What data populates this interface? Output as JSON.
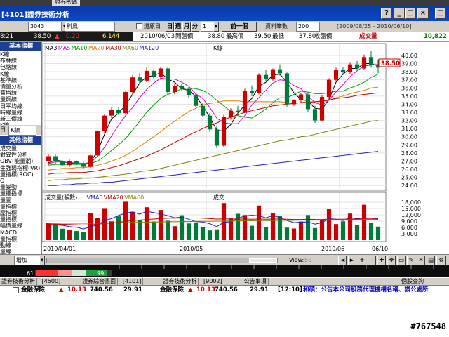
{
  "top_tab": "證券密碼",
  "window": {
    "title": "[4101]證券技術分析",
    "btn_help": "?",
    "btn_min": "_",
    "btn_max": "□",
    "btn_close": "×",
    "btn_extra": "□"
  },
  "toolbar": {
    "code_value": "3043",
    "name_value": "科風",
    "restore_label": "還原日",
    "period_day": "日",
    "period_week": "週",
    "period_month": "月",
    "period_minute": "分",
    "period_select": "1",
    "prev_button": "前一個",
    "data_count_label": "資料筆數",
    "data_count_value": "200",
    "date_range": "[2009/08/25 - 2010/06/10]"
  },
  "quote": {
    "time": "8:21",
    "price": "38.50",
    "change": "0.20",
    "volume": "6,144",
    "date": "2010/06/03",
    "open_label": "開盤價",
    "open_value": "38.80",
    "high_label": "最高價",
    "high_value": "39.50",
    "low_label": "最低",
    "low_value": "37.80",
    "close_label": "收盤價",
    "vol_label": "成交量",
    "vol_value": "10,822"
  },
  "sidebar": {
    "basic_header": "基本指標",
    "basic_items": [
      "K線",
      "布林線",
      "包絡線",
      "K線",
      "基準線",
      "價量分析",
      "寶塔線",
      "量鋼線",
      "日平均線",
      "時線量線",
      "新三價線",
      "K線"
    ],
    "period_label": "K線",
    "other_header": "其他指標",
    "other_items": [
      "成交量",
      "對異性分析",
      "OBV(能量潮)",
      "生強弱指標(VR)",
      "量指標(ROC)",
      "O",
      "量變動",
      "量擺指標",
      "量圖",
      "量指標",
      "壓指標",
      "量指標",
      "幅價量線",
      "MACD",
      "量指標",
      "動線",
      "量線"
    ],
    "bottom_select": "增加"
  },
  "chart_labels": {
    "ma_legend": [
      {
        "text": "MA3",
        "color": "#000000"
      },
      {
        "text": "MA5",
        "color": "#d000d0"
      },
      {
        "text": "MA10",
        "color": "#00a000"
      },
      {
        "text": "MA20",
        "color": "#e08000"
      },
      {
        "text": "MA30",
        "color": "#c00000"
      },
      {
        "text": "MA60",
        "color": "#808000"
      },
      {
        "text": "MA120",
        "color": "#2020c0"
      }
    ],
    "kline_tag": "K線",
    "vol_legend": [
      {
        "text": "成交量(張數)",
        "color": "#000000"
      },
      {
        "text": "VMA5",
        "color": "#2020c0"
      },
      {
        "text": "VMA20",
        "color": "#c00000"
      },
      {
        "text": "VMA60",
        "color": "#808000"
      }
    ],
    "vol_tag": "成交",
    "price_tag": "38.50",
    "x_dates": [
      "2010/04/01",
      "2010/05",
      "2010/06",
      "06/10"
    ]
  },
  "chart_data": {
    "type": "candlestick",
    "price_axis": [
      40.0,
      39.0,
      38.0,
      37.0,
      36.0,
      35.0,
      34.0,
      33.0,
      32.0,
      31.0,
      30.0,
      29.0,
      28.0,
      27.0,
      26.0,
      25.0,
      24.0
    ],
    "price_ylim": [
      23.5,
      40.6
    ],
    "volume_axis": [
      18000,
      15000,
      12000,
      9000,
      6000,
      3000
    ],
    "volume_ylim": [
      0,
      20000
    ],
    "candles": [
      [
        27.0,
        27.9,
        26.5,
        27.6
      ],
      [
        27.6,
        27.8,
        26.6,
        27.0
      ],
      [
        27.0,
        27.1,
        26.4,
        26.5
      ],
      [
        26.5,
        27.2,
        26.3,
        27.0
      ],
      [
        27.0,
        27.1,
        26.5,
        26.6
      ],
      [
        26.6,
        26.9,
        26.0,
        26.3
      ],
      [
        26.3,
        27.8,
        26.2,
        27.7
      ],
      [
        27.7,
        30.8,
        27.6,
        30.7
      ],
      [
        30.7,
        32.8,
        30.4,
        32.6
      ],
      [
        32.6,
        33.6,
        32.3,
        33.3
      ],
      [
        33.3,
        33.6,
        32.7,
        32.9
      ],
      [
        32.9,
        35.6,
        32.8,
        35.5
      ],
      [
        35.5,
        37.6,
        35.2,
        37.3
      ],
      [
        37.3,
        37.8,
        36.5,
        36.9
      ],
      [
        36.9,
        38.5,
        36.7,
        38.1
      ],
      [
        38.1,
        38.3,
        37.2,
        37.4
      ],
      [
        37.4,
        38.6,
        37.0,
        38.4
      ],
      [
        38.4,
        38.5,
        35.2,
        35.5
      ],
      [
        35.5,
        36.6,
        35.2,
        36.2
      ],
      [
        36.2,
        36.5,
        35.6,
        35.9
      ],
      [
        35.9,
        36.1,
        34.8,
        35.1
      ],
      [
        35.1,
        35.4,
        33.6,
        33.8
      ],
      [
        33.8,
        34.2,
        32.4,
        32.6
      ],
      [
        32.6,
        32.9,
        30.6,
        30.9
      ],
      [
        30.9,
        31.4,
        28.6,
        28.9
      ],
      [
        28.9,
        32.7,
        28.7,
        32.4
      ],
      [
        32.4,
        33.5,
        32.1,
        33.2
      ],
      [
        33.2,
        33.8,
        32.7,
        33.0
      ],
      [
        33.0,
        35.9,
        32.9,
        35.6
      ],
      [
        35.6,
        36.3,
        35.0,
        35.4
      ],
      [
        35.4,
        37.8,
        35.2,
        37.6
      ],
      [
        37.6,
        38.2,
        36.8,
        37.1
      ],
      [
        37.1,
        38.4,
        36.9,
        38.3
      ],
      [
        38.3,
        38.9,
        37.5,
        37.8
      ],
      [
        37.8,
        37.9,
        33.7,
        34.0
      ],
      [
        34.0,
        34.6,
        33.8,
        34.5
      ],
      [
        34.5,
        35.4,
        34.1,
        35.2
      ],
      [
        35.2,
        35.5,
        33.1,
        33.4
      ],
      [
        33.4,
        33.8,
        31.7,
        32.0
      ],
      [
        32.0,
        35.1,
        31.9,
        34.9
      ],
      [
        34.9,
        37.2,
        34.6,
        37.0
      ],
      [
        37.0,
        38.5,
        36.7,
        38.2
      ],
      [
        38.2,
        38.6,
        37.6,
        38.0
      ],
      [
        38.0,
        39.1,
        37.7,
        38.9
      ],
      [
        38.9,
        39.3,
        38.1,
        38.4
      ],
      [
        38.4,
        40.1,
        38.2,
        39.8
      ],
      [
        39.8,
        40.6,
        38.5,
        38.8
      ],
      [
        38.8,
        39.5,
        37.8,
        38.5
      ]
    ],
    "volumes": [
      8200,
      7600,
      5400,
      4900,
      4300,
      3900,
      12800,
      10400,
      15200,
      8900,
      11300,
      18200,
      13400,
      9700,
      15600,
      8800,
      14300,
      9200,
      6600,
      11800,
      7900,
      8400,
      6200,
      4600,
      5100,
      17600,
      10300,
      12500,
      11900,
      6800,
      16400,
      6100,
      12700,
      11600,
      5900,
      5500,
      8800,
      11900,
      5700,
      9400,
      14900,
      7600,
      8900,
      12600,
      7200,
      16800,
      8300,
      6400
    ],
    "ma_series": [
      {
        "name": "MA3",
        "color": "#000000",
        "values": [
          26.8,
          27.1,
          27.0,
          26.7,
          26.7,
          26.6,
          26.9,
          28.2,
          30.3,
          32.2,
          32.9,
          33.9,
          35.2,
          36.6,
          37.4,
          37.5,
          37.9,
          37.1,
          36.7,
          35.9,
          35.7,
          35.0,
          33.8,
          32.4,
          30.8,
          30.7,
          31.5,
          32.9,
          33.9,
          34.7,
          36.2,
          36.7,
          37.6,
          37.7,
          36.7,
          35.4,
          34.6,
          34.4,
          33.5,
          33.4,
          34.6,
          36.7,
          37.7,
          38.4,
          38.4,
          39.0,
          39.0,
          38.7
        ]
      },
      {
        "name": "MA5",
        "color": "#d000d0",
        "values": [
          26.7,
          26.9,
          26.9,
          26.8,
          26.8,
          26.7,
          26.8,
          27.6,
          28.7,
          30.1,
          31.4,
          32.6,
          33.6,
          34.8,
          35.8,
          36.6,
          37.2,
          37.1,
          37.1,
          36.7,
          36.2,
          35.3,
          34.7,
          33.6,
          32.3,
          31.7,
          31.6,
          31.6,
          32.6,
          33.9,
          34.8,
          35.7,
          36.6,
          37.0,
          36.9,
          36.3,
          35.9,
          35.0,
          34.2,
          33.9,
          34.5,
          35.5,
          36.4,
          37.4,
          38.1,
          38.7,
          38.8,
          38.9
        ]
      },
      {
        "name": "MA10",
        "color": "#00a000",
        "values": [
          26.5,
          26.6,
          26.6,
          26.6,
          26.6,
          26.6,
          26.7,
          27.0,
          27.6,
          28.3,
          29.0,
          29.8,
          30.8,
          31.9,
          33.0,
          33.9,
          34.7,
          35.2,
          35.5,
          35.9,
          36.0,
          35.9,
          35.7,
          35.2,
          34.5,
          33.8,
          33.1,
          32.6,
          32.4,
          32.3,
          32.8,
          33.4,
          34.2,
          34.8,
          34.8,
          35.2,
          35.6,
          35.5,
          35.3,
          35.3,
          35.4,
          35.6,
          35.6,
          36.0,
          36.3,
          36.7,
          37.3,
          37.7
        ]
      },
      {
        "name": "MA20",
        "color": "#e08000",
        "values": [
          25.9,
          26.0,
          26.1,
          26.1,
          26.2,
          26.2,
          26.3,
          26.5,
          26.7,
          27.0,
          27.3,
          27.7,
          28.2,
          28.8,
          29.4,
          30.0,
          30.6,
          31.3,
          31.9,
          32.5,
          33.1,
          33.5,
          33.9,
          34.1,
          34.2,
          34.4,
          34.4,
          34.4,
          34.3,
          34.3,
          34.3,
          34.3,
          34.3,
          34.3,
          34.2,
          34.1,
          34.2,
          34.3,
          34.3,
          34.3,
          34.5,
          34.8,
          35.0,
          35.3,
          35.5,
          35.7,
          36.0,
          36.1
        ]
      },
      {
        "name": "MA30",
        "color": "#c00000",
        "values": [
          25.4,
          25.5,
          25.5,
          25.6,
          25.6,
          25.6,
          25.7,
          25.8,
          26.0,
          26.2,
          26.4,
          26.7,
          27.0,
          27.3,
          27.6,
          28.0,
          28.4,
          28.8,
          29.3,
          29.7,
          30.2,
          30.6,
          31.0,
          31.4,
          31.7,
          32.1,
          32.4,
          32.7,
          33.0,
          33.2,
          33.4,
          33.6,
          33.8,
          33.9,
          34.0,
          34.1,
          34.2,
          34.2,
          34.3,
          34.4,
          34.5,
          34.7,
          34.8,
          34.9,
          35.1,
          35.2,
          35.3,
          35.4
        ]
      },
      {
        "name": "MA60",
        "color": "#808000",
        "values": [
          24.6,
          24.7,
          24.7,
          24.8,
          24.8,
          24.9,
          24.9,
          25.0,
          25.1,
          25.2,
          25.3,
          25.4,
          25.5,
          25.7,
          25.8,
          25.9,
          26.1,
          26.3,
          26.5,
          26.7,
          26.9,
          27.1,
          27.3,
          27.5,
          27.7,
          27.9,
          28.1,
          28.3,
          28.5,
          28.7,
          28.9,
          29.1,
          29.3,
          29.5,
          29.6,
          29.8,
          30.0,
          30.1,
          30.3,
          30.5,
          30.7,
          30.9,
          31.1,
          31.3,
          31.5,
          31.7,
          31.9,
          32.0
        ]
      },
      {
        "name": "MA120",
        "color": "#2020c0",
        "values": [
          24.0,
          24.0,
          24.1,
          24.1,
          24.2,
          24.2,
          24.3,
          24.3,
          24.4,
          24.4,
          24.5,
          24.6,
          24.7,
          24.8,
          24.9,
          25.0,
          25.1,
          25.2,
          25.3,
          25.4,
          25.5,
          25.6,
          25.7,
          25.8,
          25.9,
          26.0,
          26.1,
          26.2,
          26.3,
          26.4,
          26.5,
          26.6,
          26.7,
          26.8,
          26.9,
          27.0,
          27.1,
          27.2,
          27.3,
          27.4,
          27.5,
          27.6,
          27.7,
          27.8,
          27.9,
          28.0,
          28.1,
          28.2
        ]
      }
    ],
    "vma_series": [
      {
        "name": "VMA5",
        "color": "#2020c0",
        "values": [
          7000,
          7200,
          7000,
          6400,
          6100,
          5300,
          6300,
          7200,
          9300,
          10200,
          11700,
          12800,
          13400,
          12300,
          13600,
          13100,
          12400,
          11600,
          10600,
          10900,
          9900,
          8800,
          8600,
          7800,
          6400,
          8400,
          8700,
          10300,
          11500,
          11800,
          11500,
          10600,
          11600,
          10700,
          9300,
          8300,
          8500,
          8600,
          7600,
          8300,
          10200,
          9900,
          9300,
          10700,
          10200,
          10600,
          10500,
          10200
        ]
      },
      {
        "name": "VMA20",
        "color": "#c00000",
        "values": [
          7600,
          7600,
          7500,
          7400,
          7300,
          7200,
          7300,
          7500,
          7900,
          8100,
          8400,
          8900,
          9300,
          9500,
          9800,
          10000,
          10200,
          10400,
          10400,
          10500,
          10500,
          10500,
          10400,
          10200,
          10000,
          10100,
          10000,
          10000,
          10000,
          9900,
          10000,
          9900,
          10000,
          10000,
          9900,
          9800,
          9800,
          9900,
          9800,
          9800,
          9900,
          9900,
          9900,
          10000,
          10000,
          10100,
          10100,
          10000
        ]
      },
      {
        "name": "VMA60",
        "color": "#808000",
        "values": [
          8000,
          8000,
          8000,
          8000,
          8000,
          8000,
          8000,
          8100,
          8100,
          8200,
          8200,
          8300,
          8400,
          8400,
          8500,
          8600,
          8600,
          8700,
          8700,
          8800,
          8800,
          8900,
          8900,
          8900,
          9000,
          9000,
          9100,
          9100,
          9200,
          9200,
          9300,
          9300,
          9300,
          9400,
          9400,
          9400,
          9500,
          9500,
          9500,
          9600,
          9600,
          9600,
          9700,
          9700,
          9700,
          9800,
          9800,
          9800
        ]
      }
    ],
    "up_color": "#cc0000",
    "down_color": "#007a3a"
  },
  "viewbar": {
    "view_label": "View:",
    "view_value": "50"
  },
  "darkbar": {
    "value_a": "61",
    "value_b": "99"
  },
  "tabs": [
    "證券技術分析",
    "[4500]",
    "證券綜合畫面",
    "[4101]",
    "證券技術分析",
    "[9002]",
    "公告事項"
  ],
  "right_tab": "個股查詢",
  "ticker": {
    "name1": "金融保險",
    "price1": "10.13",
    "vol1": "740.56",
    "chg1": "29.91",
    "name2": "金融保險",
    "price2": "10.13",
    "vol2": "740.56",
    "chg2": "29.91",
    "time": "[12:10]",
    "news": "和碩：公告本公司股務代理機構名稱、辦公處所"
  },
  "watermark": "#767548"
}
